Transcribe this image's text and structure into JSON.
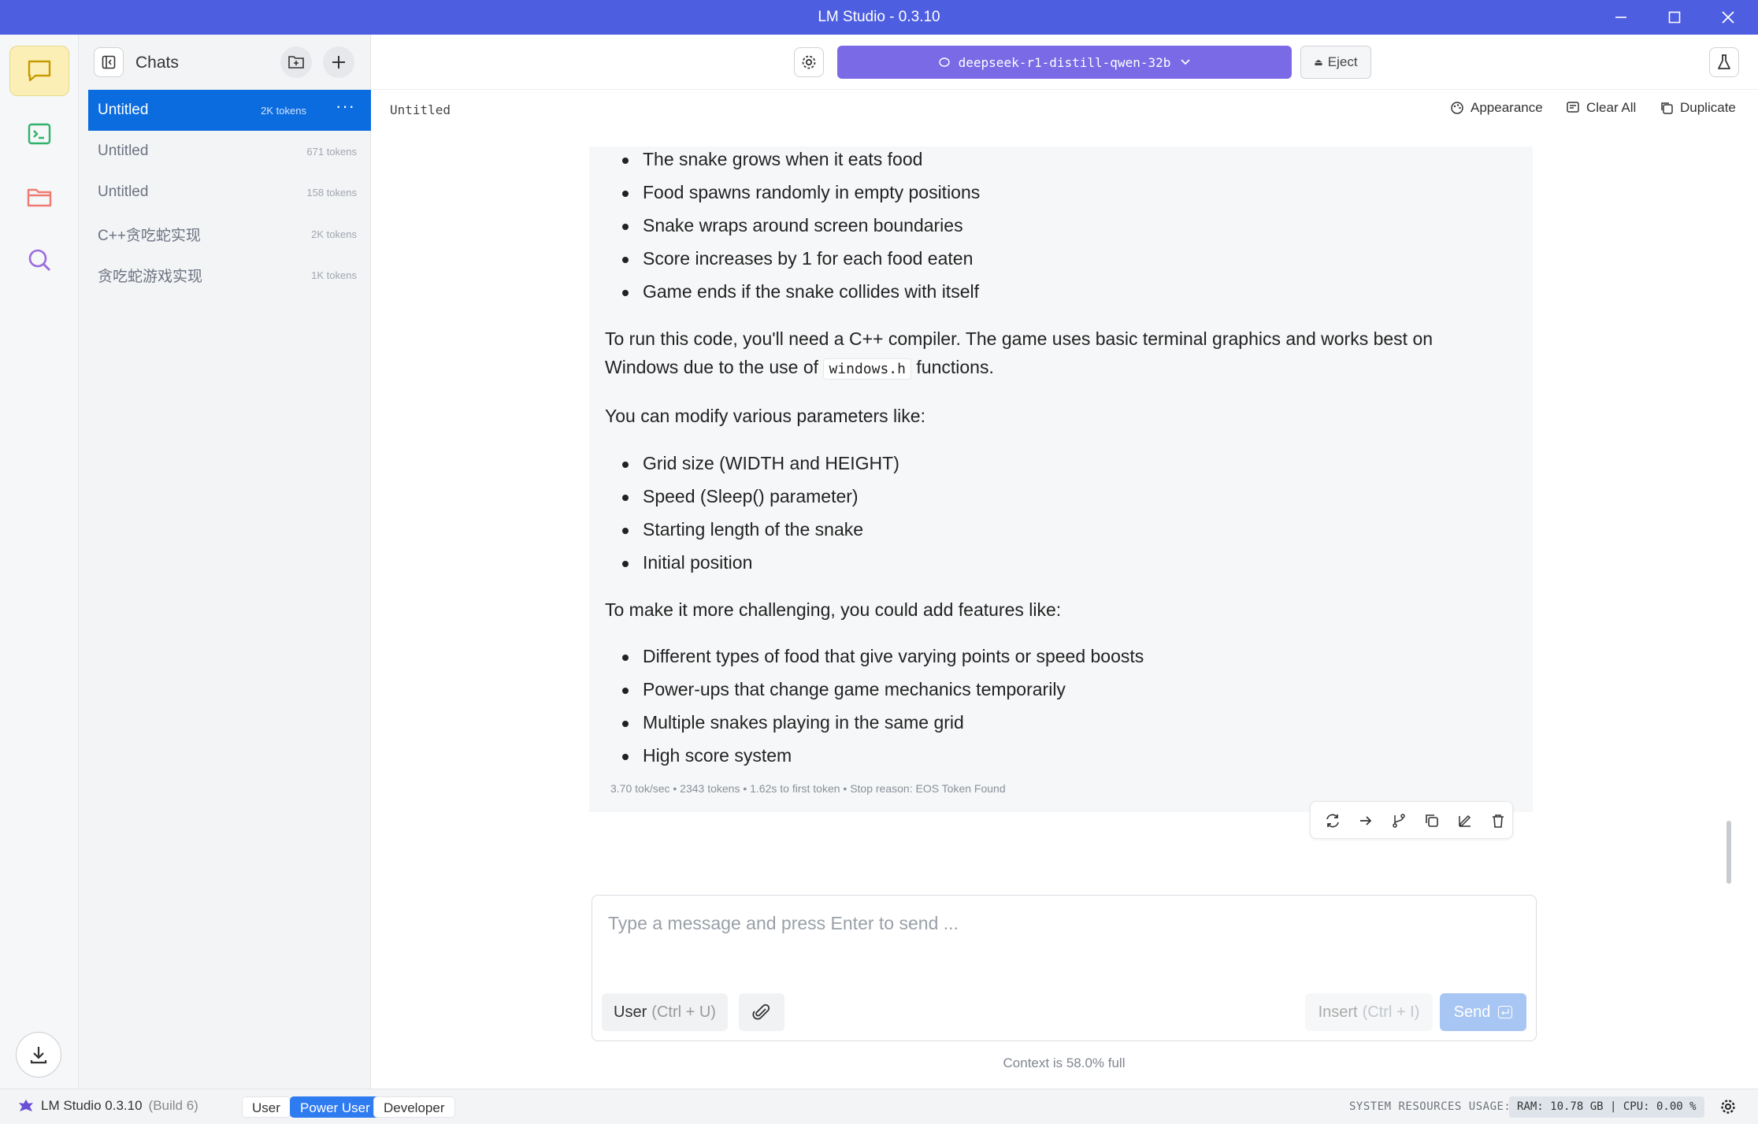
{
  "window": {
    "title": "LM Studio - 0.3.10"
  },
  "sidebar": {
    "title": "Chats",
    "chats": [
      {
        "name": "Untitled",
        "tokens": "2K tokens"
      },
      {
        "name": "Untitled",
        "tokens": "671 tokens"
      },
      {
        "name": "Untitled",
        "tokens": "158 tokens"
      },
      {
        "name": "C++贪吃蛇实现",
        "tokens": "2K tokens"
      },
      {
        "name": "贪吃蛇游戏实现",
        "tokens": "1K tokens"
      }
    ]
  },
  "topbar": {
    "model": "deepseek-r1-distill-qwen-32b",
    "eject_label": "Eject"
  },
  "subbar": {
    "chat_title": "Untitled",
    "appearance": "Appearance",
    "clear_all": "Clear All",
    "duplicate": "Duplicate"
  },
  "message": {
    "bullets_a": [
      "The snake grows when it eats food",
      "Food spawns randomly in empty positions",
      "Snake wraps around screen boundaries",
      "Score increases by 1 for each food eaten",
      "Game ends if the snake collides with itself"
    ],
    "para1_line1": "To run this code, you'll need a C++ compiler. The game uses basic terminal graphics and works best on",
    "para1_line2_pre": "Windows due to the use of",
    "para1_code": "windows.h",
    "para1_line2_post": "functions.",
    "para2": "You can modify various parameters like:",
    "bullets_b": [
      "Grid size (WIDTH and HEIGHT)",
      "Speed (Sleep() parameter)",
      "Starting length of the snake",
      "Initial position"
    ],
    "para3": "To make it more challenging, you could add features like:",
    "bullets_c": [
      "Different types of food that give varying points or speed boosts",
      "Power-ups that change game mechanics temporarily",
      "Multiple snakes playing in the same grid",
      "High score system"
    ],
    "stats": "3.70 tok/sec  •  2343 tokens  •  1.62s to first token  •  Stop reason: EOS Token Found"
  },
  "composer": {
    "placeholder": "Type a message and press Enter to send ...",
    "role": "User",
    "role_shortcut": "(Ctrl + U)",
    "insert": "Insert",
    "insert_shortcut": "(Ctrl + I)",
    "send": "Send",
    "context": "Context is 58.0% full"
  },
  "statusbar": {
    "app": "LM Studio 0.3.10",
    "build": "(Build 6)",
    "modes": [
      "User",
      "Power User",
      "Developer"
    ],
    "resources_label": "SYSTEM RESOURCES USAGE:",
    "resources": "RAM: 10.78 GB  |  CPU: 0.00 %"
  },
  "colors": {
    "titlebar": "#4e5ee0",
    "model_pill": "#7a6ae6",
    "active_chat": "#0a6cdf",
    "send": "#a8c6f3"
  }
}
